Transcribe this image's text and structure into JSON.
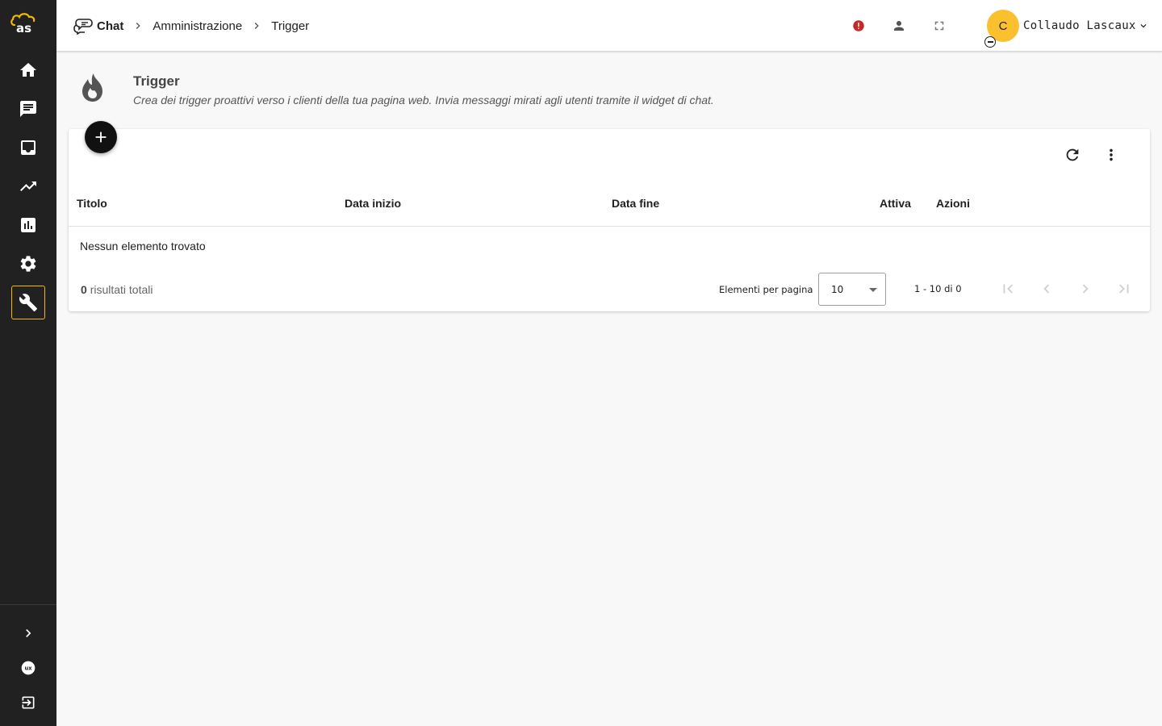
{
  "app": {
    "logo_text": "as",
    "sidebar": {
      "items": [
        {
          "name": "home",
          "icon": "home-icon"
        },
        {
          "name": "chat",
          "icon": "message-icon"
        },
        {
          "name": "inbox",
          "icon": "inbox-icon"
        },
        {
          "name": "trends",
          "icon": "trending-up-icon"
        },
        {
          "name": "reports",
          "icon": "bar-chart-icon"
        },
        {
          "name": "settings",
          "icon": "gear-icon"
        },
        {
          "name": "administration",
          "icon": "wrench-icon",
          "active": true
        }
      ],
      "bottom_items": [
        {
          "name": "expand",
          "icon": "chevron-right-icon"
        },
        {
          "name": "ux",
          "icon": "ux-icon",
          "label": "UX"
        },
        {
          "name": "logout",
          "icon": "logout-icon"
        }
      ],
      "active_color": "#f5b800"
    }
  },
  "header": {
    "breadcrumbs": [
      "Chat",
      "Amministrazione",
      "Trigger"
    ],
    "icons": [
      "alert-icon",
      "person-icon",
      "fullscreen-icon"
    ],
    "alert_color": "#c62828",
    "user": {
      "initial": "C",
      "name": "Collaudo Lascaux",
      "avatar_color": "#fbc02d"
    }
  },
  "page": {
    "title": "Trigger",
    "subtitle": "Crea dei trigger proattivi verso i clienti della tua pagina web. Invia messaggi mirati agli utenti tramite il widget di chat.",
    "icon": "fire-icon"
  },
  "table": {
    "columns": [
      "Titolo",
      "Data inizio",
      "Data fine",
      "Attiva",
      "Azioni"
    ],
    "rows": [],
    "empty_message": "Nessun elemento trovato",
    "total_count": "0",
    "total_label": "risultati totali",
    "per_page_label": "Elementi per pagina",
    "per_page_value": "10",
    "range_label": "1 - 10 di 0"
  }
}
